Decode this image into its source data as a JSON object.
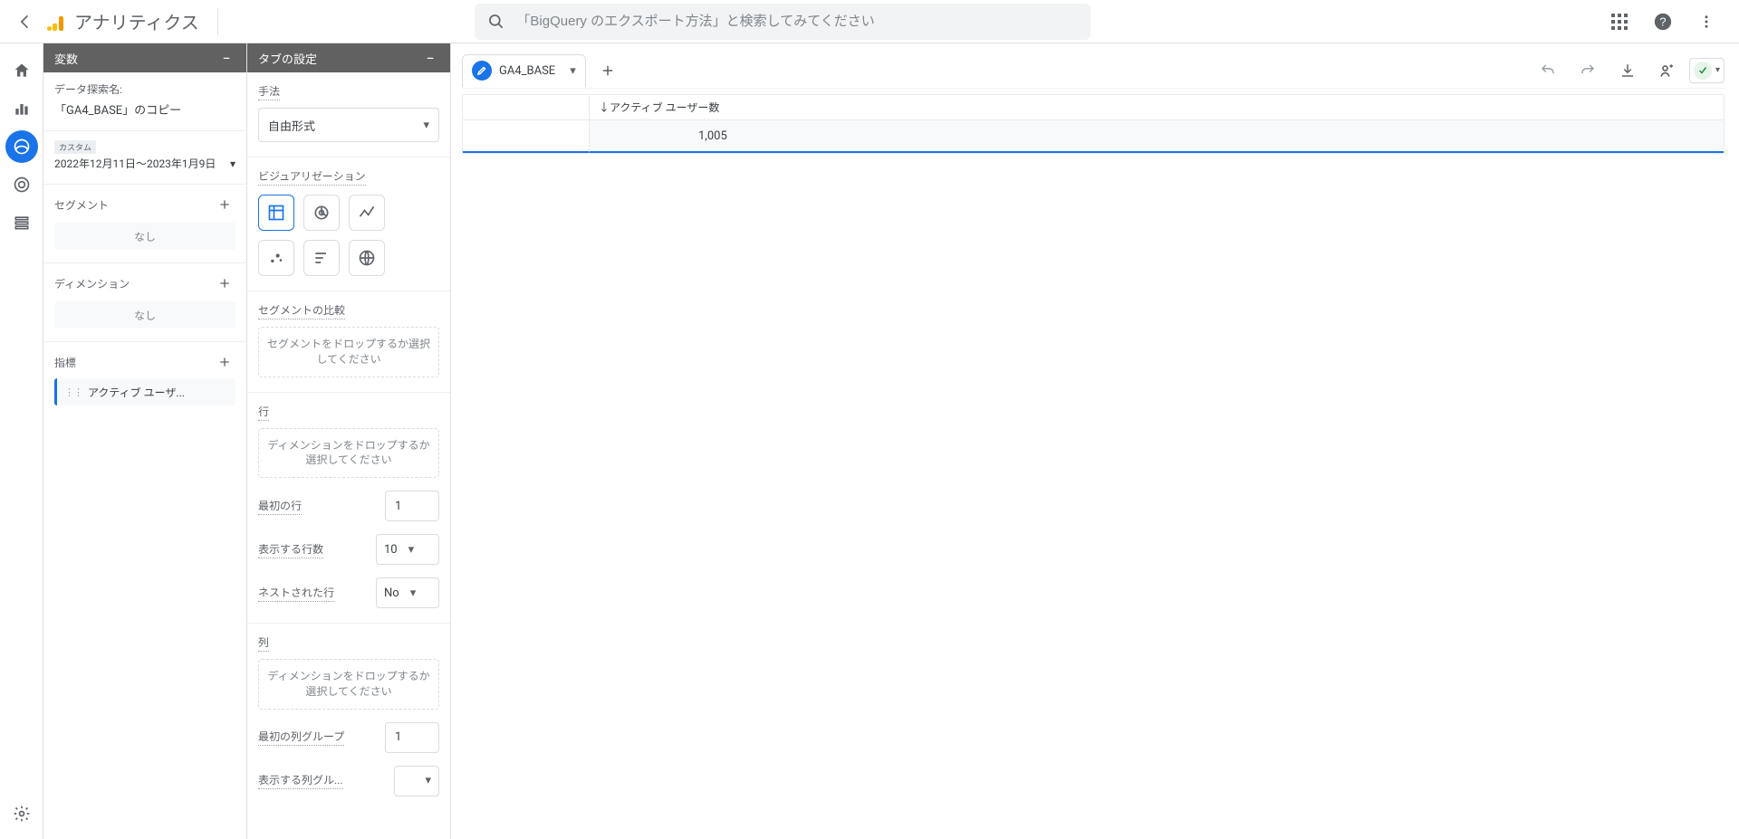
{
  "header": {
    "product_name": "アナリティクス",
    "search_placeholder": "「BigQuery のエクスポート方法」と検索してみてください"
  },
  "variables_panel": {
    "title": "変数",
    "exploration_label": "データ探索名:",
    "exploration_value": "「GA4_BASE」のコピー",
    "date_badge": "カスタム",
    "date_range": "2022年12月11日～2023年1月9日",
    "segments_label": "セグメント",
    "segments_empty": "なし",
    "dimensions_label": "ディメンション",
    "dimensions_empty": "なし",
    "metrics_label": "指標",
    "metric_chip": "アクティブ ユーザ..."
  },
  "settings_panel": {
    "title": "タブの設定",
    "technique_label": "手法",
    "technique_value": "自由形式",
    "viz_label": "ビジュアリゼーション",
    "segment_compare_label": "セグメントの比較",
    "segment_compare_drop": "セグメントをドロップするか選択してください",
    "rows_label": "行",
    "rows_drop": "ディメンションをドロップするか選択してください",
    "start_row_label": "最初の行",
    "start_row_value": "1",
    "show_rows_label": "表示する行数",
    "show_rows_value": "10",
    "nested_label": "ネストされた行",
    "nested_value": "No",
    "cols_label": "列",
    "cols_drop": "ディメンションをドロップするか選択してください",
    "start_col_group_label": "最初の列グループ",
    "start_col_group_value": "1",
    "show_col_groups_label": "表示する列グル..."
  },
  "canvas": {
    "tab_name": "GA4_BASE",
    "metric_header": "↓アクティブ ユーザー数",
    "metric_value": "1,005"
  }
}
